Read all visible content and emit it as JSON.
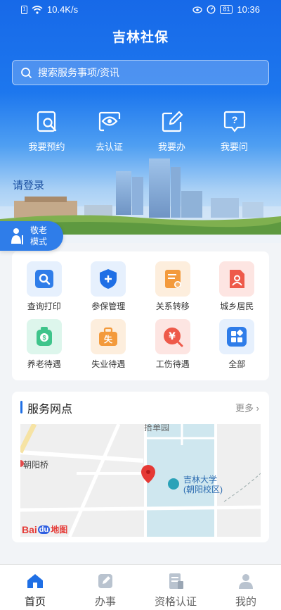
{
  "status_bar": {
    "speed": "10.4K/s",
    "battery": "81",
    "time": "10:36"
  },
  "app_title": "吉林社保",
  "search": {
    "placeholder": "搜索服务事项/资讯"
  },
  "quick_actions": [
    {
      "label": "我要预约",
      "icon": "search-document-icon"
    },
    {
      "label": "去认证",
      "icon": "eye-icon"
    },
    {
      "label": "我要办",
      "icon": "edit-icon"
    },
    {
      "label": "我要问",
      "icon": "question-icon"
    }
  ],
  "login_prompt": "请登录",
  "elder_mode": {
    "line1": "敬老",
    "line2": "模式"
  },
  "services": [
    {
      "label": "查询打印",
      "icon": "search-icon",
      "color": "#2f7de9"
    },
    {
      "label": "参保管理",
      "icon": "shield-plus-icon",
      "color": "#1f6fe5"
    },
    {
      "label": "关系转移",
      "icon": "document-transfer-icon",
      "color": "#f39a3c"
    },
    {
      "label": "城乡居民",
      "icon": "resident-document-icon",
      "color": "#ee5a4a"
    },
    {
      "label": "养老待遇",
      "icon": "pension-bag-icon",
      "color": "#3fc48b"
    },
    {
      "label": "失业待遇",
      "icon": "unemployment-briefcase-icon",
      "color": "#f39a3c"
    },
    {
      "label": "工伤待遇",
      "icon": "injury-yen-icon",
      "color": "#ee5a4a"
    },
    {
      "label": "全部",
      "icon": "all-grid-icon",
      "color": "#2f7de9"
    }
  ],
  "service_points": {
    "title": "服务网点",
    "more": "更多",
    "map": {
      "label_bridge": "朝阳桥",
      "label_school_1": "吉林大学",
      "label_school_2": "(朝阳校区)",
      "label_top": "拾单园",
      "brand_1": "Bai",
      "brand_2": "du",
      "brand_3": "地图"
    }
  },
  "bottom_nav": [
    {
      "label": "首页",
      "icon": "home-icon",
      "active": true
    },
    {
      "label": "办事",
      "icon": "edit-icon",
      "active": false
    },
    {
      "label": "资格认证",
      "icon": "certification-icon",
      "active": false
    },
    {
      "label": "我的",
      "icon": "user-icon",
      "active": false
    }
  ],
  "colors": {
    "primary": "#1f6fe5",
    "hero_top": "#1769e8",
    "background": "#f2f4f7"
  }
}
